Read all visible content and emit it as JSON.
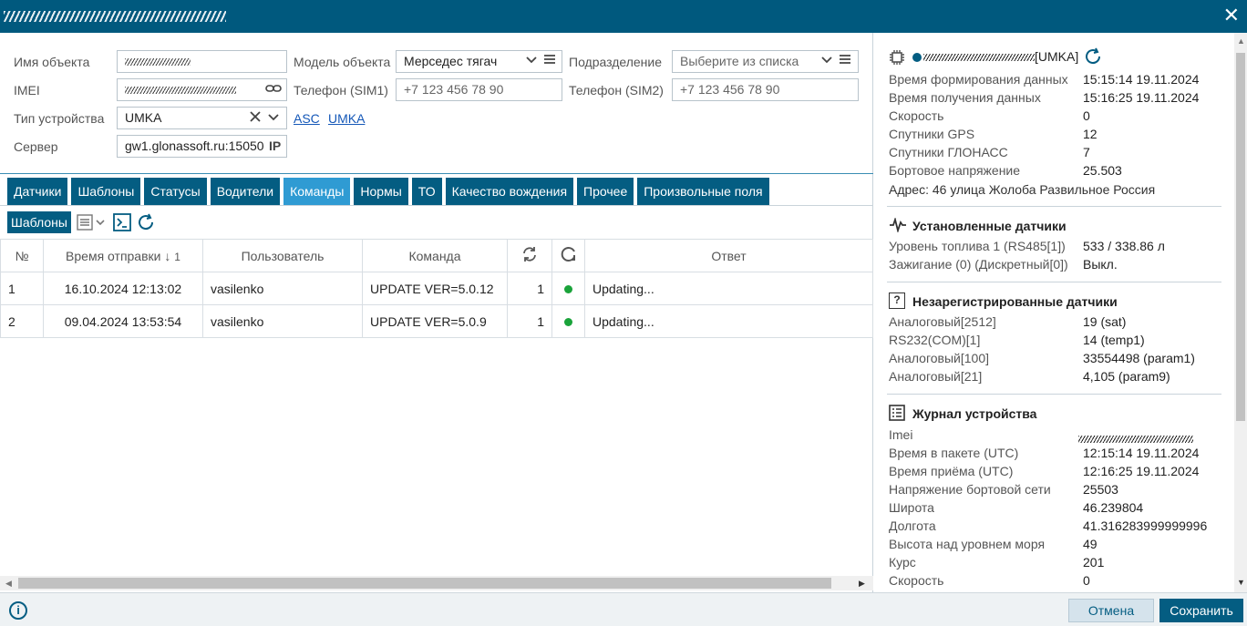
{
  "window": {
    "title_obfuscated": true,
    "close_icon": "close-icon"
  },
  "form": {
    "object_name_label": "Имя объекта",
    "object_model_label": "Модель объекта",
    "object_model_value": "Мерседес тягач",
    "subdivision_label": "Подразделение",
    "subdivision_placeholder": "Выберите из списка",
    "imei_label": "IMEI",
    "phone1_label": "Телефон (SIM1)",
    "phone1_placeholder": "+7 123 456 78 90",
    "phone2_label": "Телефон (SIM2)",
    "phone2_placeholder": "+7 123 456 78 90",
    "device_type_label": "Тип устройства",
    "device_type_value": "UMKA",
    "link_asc": "ASC",
    "link_umka": "UMKA",
    "server_label": "Сервер",
    "server_value": "gw1.glonassoft.ru:15050",
    "server_ip_tag": "IP"
  },
  "tabs": [
    "Датчики",
    "Шаблоны",
    "Статусы",
    "Водители",
    "Команды",
    "Нормы",
    "ТО",
    "Качество вождения",
    "Прочее",
    "Произвольные поля"
  ],
  "active_tab": "Команды",
  "toolbar": {
    "templates_button": "Шаблоны"
  },
  "table": {
    "headers": {
      "num": "№",
      "time": "Время отправки",
      "sort_arrow": "↓",
      "sort_index": "1",
      "user": "Пользователь",
      "command": "Команда",
      "answer": "Ответ"
    },
    "rows": [
      {
        "num": "1",
        "time": "16.10.2024 12:13:02",
        "user": "vasilenko",
        "command": "UPDATE VER=5.0.12",
        "count": "1",
        "status": "green",
        "answer": "Updating..."
      },
      {
        "num": "2",
        "time": "09.04.2024 13:53:54",
        "user": "vasilenko",
        "command": "UPDATE VER=5.0.9",
        "count": "1",
        "status": "green",
        "answer": "Updating..."
      }
    ]
  },
  "panel": {
    "device_suffix": "[UMKA]",
    "status_color": "#045d82",
    "info": [
      {
        "k": "Время формирования данных",
        "v": "15:15:14 19.11.2024"
      },
      {
        "k": "Время получения данных",
        "v": "15:16:25 19.11.2024"
      },
      {
        "k": "Скорость",
        "v": "0"
      },
      {
        "k": "Спутники GPS",
        "v": "12"
      },
      {
        "k": "Спутники ГЛОНАСС",
        "v": "7"
      },
      {
        "k": "Бортовое напряжение",
        "v": "25.503"
      }
    ],
    "address_label": "Адрес:",
    "address_value": "46 улица Жолоба Развильное Россия",
    "installed_title": "Установленные датчики",
    "installed": [
      {
        "k": "Уровень топлива 1 (RS485[1])",
        "v": "533 / 338.86 л"
      },
      {
        "k": "Зажигание (0) (Дискретный[0])",
        "v": "Выкл."
      }
    ],
    "unregistered_title": "Незарегистрированные датчики",
    "unregistered": [
      {
        "k": "Аналоговый[2512]",
        "v": "19 (sat)"
      },
      {
        "k": "RS232(COM)[1]",
        "v": "14 (temp1)"
      },
      {
        "k": "Аналоговый[100]",
        "v": "33554498 (param1)"
      },
      {
        "k": "Аналоговый[21]",
        "v": "4,105 (param9)"
      }
    ],
    "journal_title": "Журнал устройства",
    "journal": [
      {
        "k": "Imei",
        "v": ""
      },
      {
        "k": "Время в пакете (UTC)",
        "v": "12:15:14 19.11.2024"
      },
      {
        "k": "Время приёма (UTC)",
        "v": "12:16:25 19.11.2024"
      },
      {
        "k": "Напряжение бортовой сети",
        "v": "25503"
      },
      {
        "k": "Широта",
        "v": "46.239804"
      },
      {
        "k": "Долгота",
        "v": "41.316283999999996"
      },
      {
        "k": "Высота над уровнем моря",
        "v": "49"
      },
      {
        "k": "Курс",
        "v": "201"
      },
      {
        "k": "Скорость",
        "v": "0"
      }
    ]
  },
  "footer": {
    "cancel": "Отмена",
    "save": "Сохранить",
    "info_icon": "info-icon"
  }
}
